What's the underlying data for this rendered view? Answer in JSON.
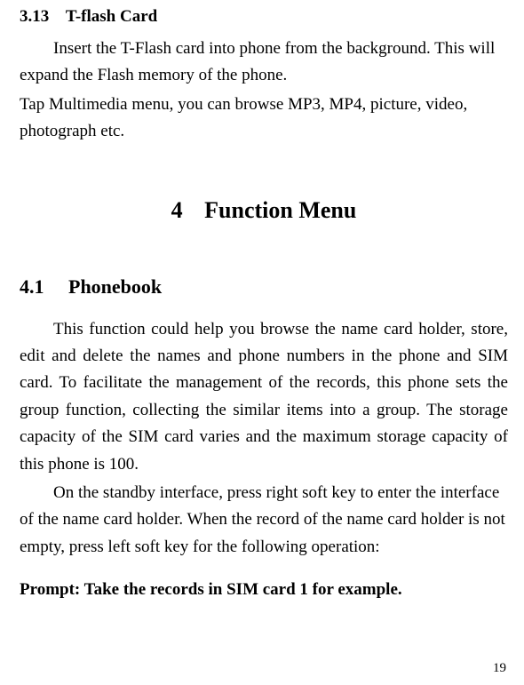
{
  "section313": {
    "number": "3.13",
    "title": "T-flash Card",
    "para1": "Insert the T-Flash card into phone from the background. This will expand the Flash memory of the phone.",
    "para2": "Tap Multimedia menu, you can browse MP3, MP4, picture, video, photograph etc."
  },
  "chapter4": {
    "number": "4",
    "title": "Function Menu"
  },
  "section41": {
    "number": "4.1",
    "title": "Phonebook",
    "para1": "This function could help you browse the name card holder, store, edit and delete the names and phone numbers in the phone and SIM card. To facilitate the management of the records, this phone sets the group function, collecting the similar items into a group. The storage capacity of the SIM card varies and the maximum storage capacity of this phone is 100.",
    "para2": "On the standby interface, press right soft key to enter the interface of the name card holder. When the record of the name card holder is not empty, press left soft key for the following operation:",
    "prompt": "Prompt: Take the records in SIM card 1 for example."
  },
  "pageNumber": "19"
}
